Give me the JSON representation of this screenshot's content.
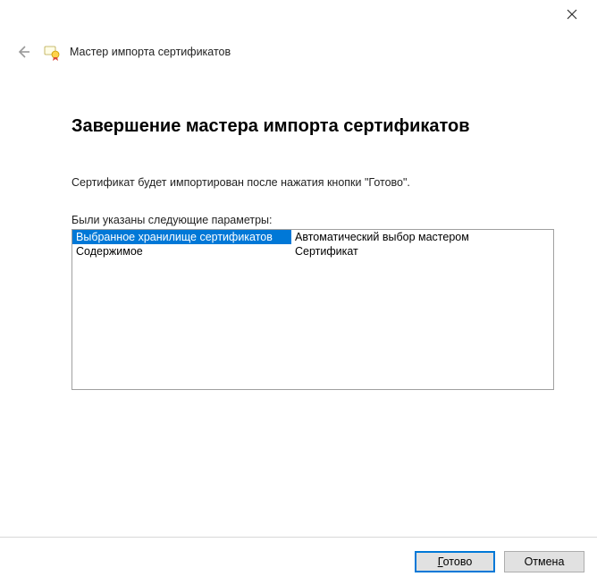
{
  "window": {
    "wizard_title": "Мастер импорта сертификатов"
  },
  "page": {
    "heading": "Завершение мастера импорта сертификатов",
    "description": "Сертификат будет импортирован после нажатия кнопки \"Готово\".",
    "params_label": "Были указаны следующие параметры:",
    "rows": [
      {
        "key": "Выбранное хранилище сертификатов",
        "value": "Автоматический выбор мастером",
        "selected": true
      },
      {
        "key": "Содержимое",
        "value": "Сертификат",
        "selected": false
      }
    ]
  },
  "buttons": {
    "finish_prefix": "Г",
    "finish_rest": "отово",
    "cancel": "Отмена"
  }
}
